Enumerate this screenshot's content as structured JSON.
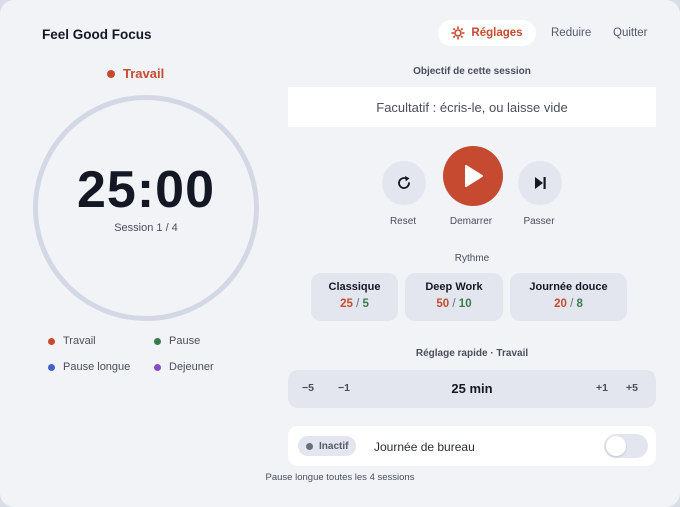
{
  "app": {
    "title": "Feel Good Focus"
  },
  "nav": {
    "settings_label": "Réglages",
    "reduce_label": "Reduire",
    "quit_label": "Quitter"
  },
  "timer": {
    "mode_label": "Travail",
    "time": "25:00",
    "session": "Session 1 / 4"
  },
  "legend": [
    {
      "label": "Travail",
      "color": "#c64a2f"
    },
    {
      "label": "Pause",
      "color": "#3a7b4e"
    },
    {
      "label": "Pause longue",
      "color": "#3f63c8"
    },
    {
      "label": "Dejeuner",
      "color": "#8e49c7"
    }
  ],
  "goal": {
    "heading": "Objectif de cette session",
    "placeholder": "Facultatif : écris-le, ou laisse vide"
  },
  "controls": {
    "reset_label": "Reset",
    "start_label": "Demarrer",
    "skip_label": "Passer"
  },
  "rhythm": {
    "heading": "Rythme",
    "presets": [
      {
        "name": "Classique",
        "work": "25",
        "sep": " / ",
        "pause": "5"
      },
      {
        "name": "Deep Work",
        "work": "50",
        "sep": " / ",
        "pause": "10"
      },
      {
        "name": "Journée douce",
        "work": "20",
        "sep": " / ",
        "pause": "8"
      }
    ]
  },
  "quick": {
    "heading": "Réglage rapide · Travail",
    "minus5": "−5",
    "minus1": "−1",
    "value": "25 min",
    "plus1": "+1",
    "plus5": "+5"
  },
  "bureau": {
    "status": "Inactif",
    "label": "Journée de bureau",
    "enabled": false
  },
  "footer": {
    "text": "Pause longue toutes les 4 sessions"
  },
  "colors": {
    "accent": "#c64a2f",
    "green": "#3a7b4e",
    "ring": "#d3d8e4"
  }
}
